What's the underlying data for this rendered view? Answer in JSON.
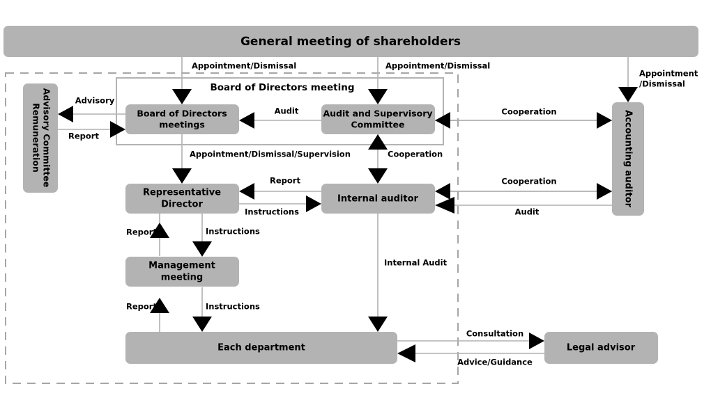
{
  "diagram": {
    "title_node": "General meeting of shareholders",
    "frame_title": "Board of Directors meeting"
  },
  "nodes": {
    "general_meeting": "General meeting of shareholders",
    "remuneration_committee_line1": "Remuneration",
    "remuneration_committee_line2": "Advisory Committee",
    "board_of_directors_line1": "Board of Directors",
    "board_of_directors_line2": "meetings",
    "audit_supervisory_line1": "Audit and Supervisory",
    "audit_supervisory_line2": "Committee",
    "accounting_auditor": "Accounting auditor",
    "representative_director_line1": "Representative",
    "representative_director_line2": "Director",
    "internal_auditor": "Internal auditor",
    "management_meeting_line1": "Management",
    "management_meeting_line2": "meeting",
    "each_department": "Each department",
    "legal_advisor": "Legal advisor"
  },
  "edge_labels": {
    "appt_dismissal_board": "Appointment/Dismissal",
    "appt_dismissal_audit": "Appointment/Dismissal",
    "appt_dismissal_acct_line1": "Appointment",
    "appt_dismissal_acct_line2": "/Dismissal",
    "advisory": "Advisory",
    "report_remuneration": "Report",
    "audit_board": "Audit",
    "cooperation_asc_acct": "Cooperation",
    "appt_dismissal_supervision": "Appointment/Dismissal/Supervision",
    "cooperation_asc_internal": "Cooperation",
    "report_internal_to_rep": "Report",
    "instructions_rep_to_internal": "Instructions",
    "cooperation_internal_acct": "Cooperation",
    "audit_acct_to_internal": "Audit",
    "report_mgmt_to_rep": "Report",
    "instructions_rep_to_mgmt": "Instructions",
    "internal_audit": "Internal Audit",
    "report_dept_to_mgmt": "Report",
    "instructions_mgmt_to_dept": "Instructions",
    "consultation": "Consultation",
    "advice_guidance": "Advice/Guidance"
  },
  "colors": {
    "node_fill": "#b3b3b3",
    "connector": "#b0b0b0",
    "arrow": "#000000",
    "dashed_frame": "#a6a6a6",
    "background": "#ffffff"
  }
}
